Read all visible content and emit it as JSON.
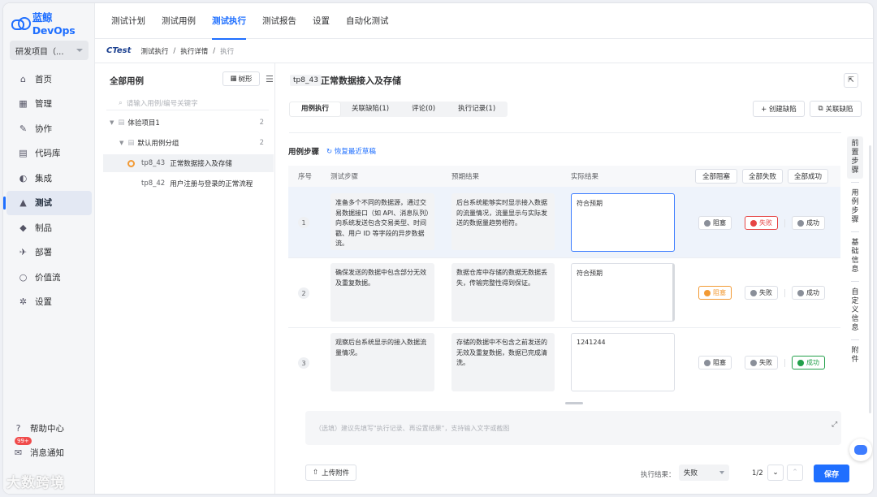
{
  "brand": {
    "logo_text": "蓝鲸DevOps"
  },
  "project": {
    "name": "研发项目（..."
  },
  "sidebar": {
    "items": [
      {
        "label": "首页",
        "icon": "home-icon"
      },
      {
        "label": "管理",
        "icon": "manage-icon"
      },
      {
        "label": "协作",
        "icon": "collab-icon"
      },
      {
        "label": "代码库",
        "icon": "repo-icon"
      },
      {
        "label": "集成",
        "icon": "integration-icon"
      },
      {
        "label": "测试",
        "icon": "test-icon",
        "active": true
      },
      {
        "label": "制品",
        "icon": "artifact-icon"
      },
      {
        "label": "部署",
        "icon": "deploy-icon"
      },
      {
        "label": "价值流",
        "icon": "valuestream-icon"
      },
      {
        "label": "设置",
        "icon": "settings-icon"
      }
    ],
    "help": "帮助中心",
    "notify": "消息通知",
    "notify_badge": "99+"
  },
  "topnav": {
    "tabs": [
      "测试计划",
      "测试用例",
      "测试执行",
      "测试报告",
      "设置",
      "自动化测试"
    ],
    "active": "测试执行"
  },
  "breadcrumb": {
    "brand": "CTest",
    "items": [
      "测试执行",
      "执行详情",
      "执行"
    ]
  },
  "tree": {
    "title": "全部用例",
    "view_button": "树形",
    "search_placeholder": "请输入用例/编号关键字",
    "nodes": [
      {
        "label": "体验项目1",
        "count": "2"
      },
      {
        "label": "默认用例分组",
        "count": "2"
      },
      {
        "id": "tp8_43",
        "label": "正常数据接入及存储",
        "selected": true
      },
      {
        "id": "tp8_42",
        "label": "用户注册与登录的正常流程"
      }
    ]
  },
  "case": {
    "id": "tp8_43",
    "title": "正常数据接入及存储"
  },
  "tabs": {
    "items": [
      "用例执行",
      "关联缺陷(1)",
      "评论(0)",
      "执行记录(1)"
    ],
    "active": "用例执行",
    "create_defect": "+ 创建缺陷",
    "link_defect": "关联缺陷"
  },
  "steps": {
    "title": "用例步骤",
    "restore": "恢复最近草稿",
    "columns": {
      "no": "序号",
      "step": "测试步骤",
      "expected": "预期结果",
      "actual": "实际结果"
    },
    "bulk": {
      "block_all": "全部阻塞",
      "fail_all": "全部失败",
      "pass_all": "全部成功"
    },
    "buttons": {
      "block": "阻塞",
      "fail": "失败",
      "pass": "成功"
    },
    "rows": [
      {
        "no": "1",
        "step": "准备多个不同的数据源，通过交易数据接口（如 API、消息队列）向系统发送包含交易类型、时间戳、用户 ID 等字段的异步数据流。",
        "expected": "后台系统能够实时显示接入数据的流量情况，流量显示与实际发送的数据量趋势相符。",
        "actual": "符合预期",
        "result": "fail"
      },
      {
        "no": "2",
        "step": "确保发送的数据中包含部分无效及重复数据。",
        "expected": "数据仓库中存储的数据无数据丢失，传输完整性得到保证。",
        "actual": "符合预期",
        "result": "block"
      },
      {
        "no": "3",
        "step": "观察后台系统显示的接入数据流量情况。",
        "expected": "存储的数据中不包含之前发送的无效及重复数据，数据已完成清洗。",
        "actual": "1241244",
        "result": "pass"
      }
    ]
  },
  "comment": {
    "placeholder": "（选填）建议先填写\"执行记录、再设置结果\"，支持输入文字或截图"
  },
  "footer": {
    "upload": "上传附件",
    "result_label": "执行结果：",
    "result_value": "失败",
    "page": "1/2",
    "save": "保存"
  },
  "right_tabs": [
    "前置步骤",
    "用例步骤",
    "基础信息",
    "自定义信息",
    "附件"
  ],
  "watermark": "大数跨境"
}
